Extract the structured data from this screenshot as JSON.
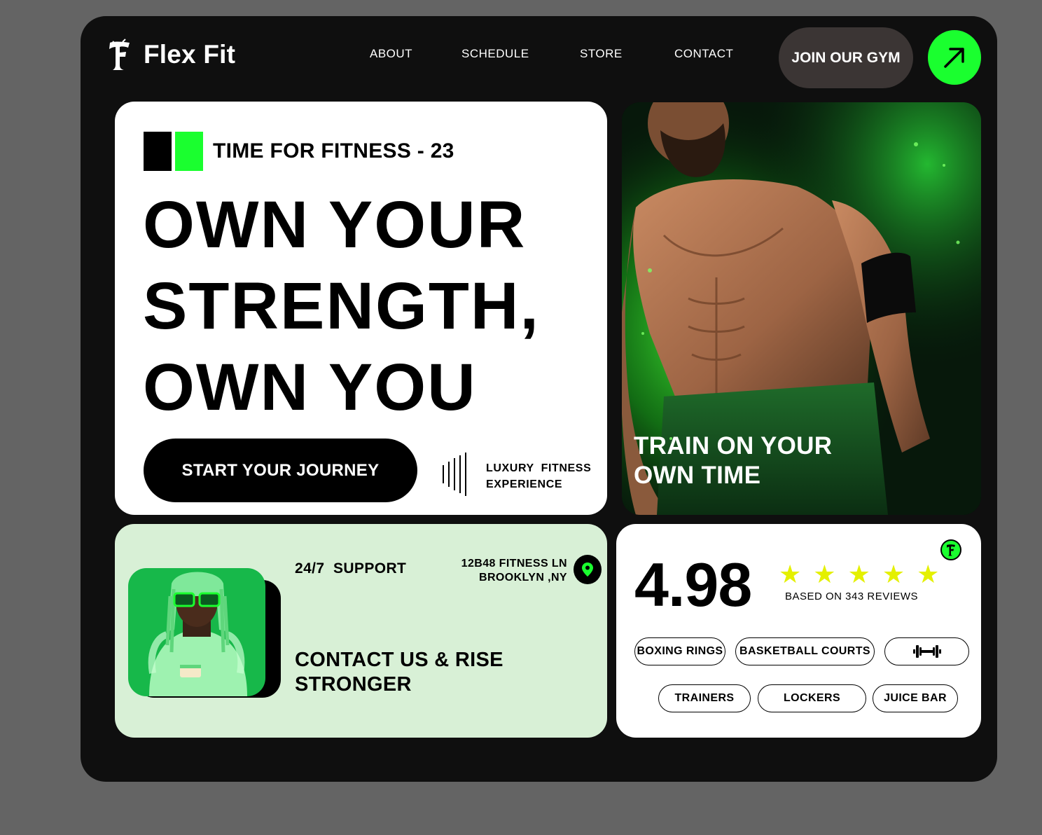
{
  "header": {
    "brand": "Flex Fit",
    "nav": [
      "ABOUT",
      "SCHEDULE",
      "STORE",
      "CONTACT"
    ],
    "join_label": "JOIN OUR GYM",
    "icons": {
      "logo": "letter-f-logo-icon",
      "arrow": "arrow-up-right-icon"
    }
  },
  "hero": {
    "kicker": "TIME FOR FITNESS - 23",
    "headline": [
      "OWN YOUR",
      "STRENGTH,",
      "OWN YOU"
    ],
    "cta_label": "START YOUR JOURNEY",
    "tagline": [
      "LUXURY  FITNESS",
      "EXPERIENCE"
    ]
  },
  "photo": {
    "caption": [
      "TRAIN ON YOUR",
      "OWN TIME"
    ]
  },
  "contact": {
    "support": "24/7  SUPPORT",
    "address": [
      "12B48 FITNESS LN",
      "BROOKLYN ,NY"
    ],
    "title": [
      "CONTACT US & RISE",
      "STRONGER"
    ]
  },
  "rating": {
    "score": "4.98",
    "stars": 5,
    "reviews": "BASED ON 343 REVIEWS",
    "amenities_row1": [
      "BOXING RINGS",
      "BASKETBALL COURTS"
    ],
    "amenities_row2": [
      "TRAINERS",
      "LOCKERS",
      "JUICE BAR"
    ],
    "icons": [
      "dumbbell-icon",
      "map-pin-icon",
      "star-icon"
    ]
  },
  "colors": {
    "accent_green": "#1aff2f",
    "frame": "#0f0f0f",
    "page_bg": "#646464",
    "contact_bg": "#d8f0d6",
    "star": "#e4f000"
  }
}
